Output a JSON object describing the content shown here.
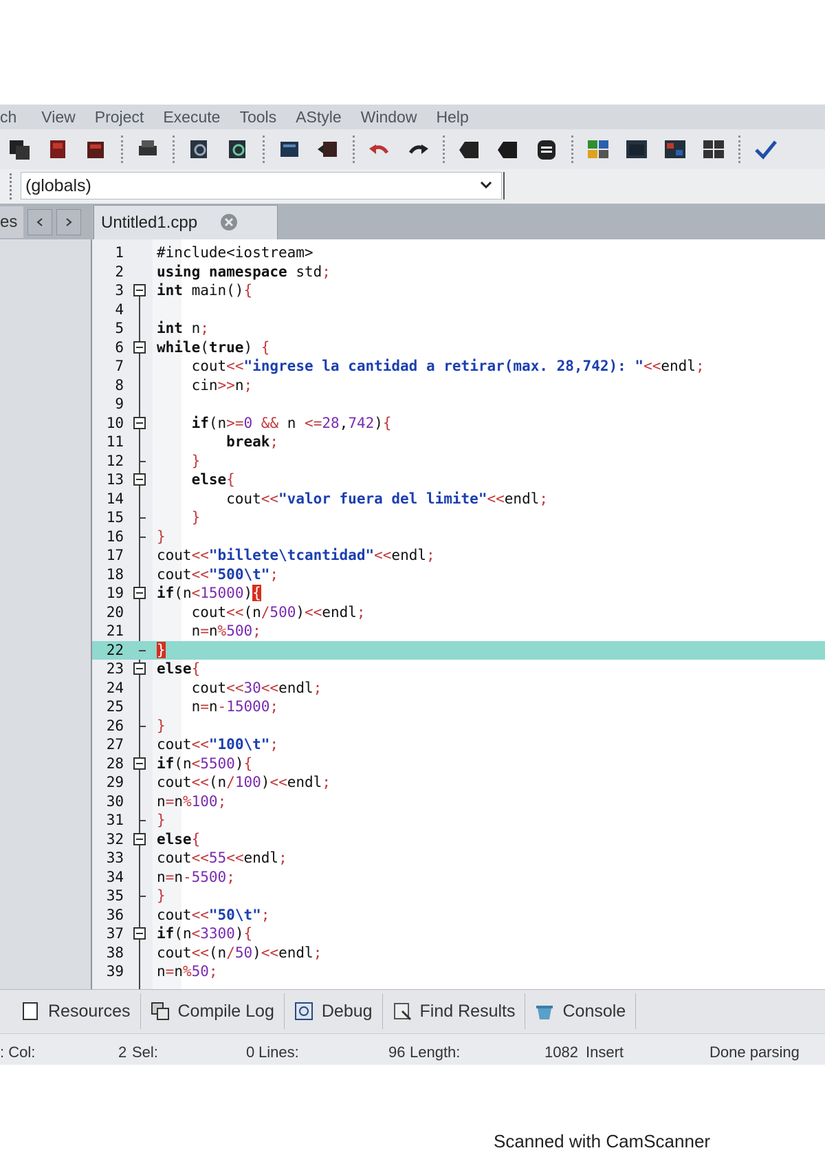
{
  "menu": [
    "ch",
    "View",
    "Project",
    "Execute",
    "Tools",
    "AStyle",
    "Window",
    "Help"
  ],
  "toolbar_icons": [
    "save-icon",
    "save-all-icon",
    "close-file-icon",
    "print-icon",
    "find-icon",
    "replace-icon",
    "indent-icon",
    "unindent-icon",
    "undo-icon",
    "redo-icon",
    "bookmark-icon",
    "goto-bookmark-icon",
    "compile-icon",
    "layout-icon",
    "panel-icon",
    "color-grid-icon",
    "tile-icon",
    "check-icon"
  ],
  "scope_combo": {
    "value": "(globals)"
  },
  "project_panel": {
    "tab_label": "es"
  },
  "file_tab": {
    "name": "Untitled1.cpp"
  },
  "code_lines": [
    "#include<iostream>",
    "using namespace std;",
    "int main(){",
    "",
    "int n;",
    "while(true) {",
    "    cout<<\"ingrese la cantidad a retirar(max. 28,742): \"<<endl;",
    "    cin>>n;",
    "",
    "    if(n>=0 && n <=28,742){",
    "        break;",
    "    }",
    "    else{",
    "        cout<<\"valor fuera del limite\"<<endl;",
    "    }",
    "}",
    "cout<<\"billete\\tcantidad\"<<endl;",
    "cout<<\"500\\t\";",
    "if(n<15000){",
    "    cout<<(n/500)<<endl;",
    "    n=n%500;",
    "}",
    "else{",
    "    cout<<30<<endl;",
    "    n=n-15000;",
    "}",
    "cout<<\"100\\t\";",
    "if(n<5500){",
    "cout<<(n/100)<<endl;",
    "n=n%100;",
    "}",
    "else{",
    "cout<<55<<endl;",
    "n=n-5500;",
    "}",
    "cout<<\"50\\t\";",
    "if(n<3300){",
    "cout<<(n/50)<<endl;",
    "n=n%50;"
  ],
  "highlighted_line": 22,
  "bottom_tabs": [
    {
      "label": "Resources",
      "icon": "resources-icon"
    },
    {
      "label": "Compile Log",
      "icon": "compile-log-icon"
    },
    {
      "label": "Debug",
      "icon": "debug-icon"
    },
    {
      "label": "Find Results",
      "icon": "find-results-icon"
    },
    {
      "label": "Console",
      "icon": "console-icon"
    }
  ],
  "status": {
    "col_label": ": Col:",
    "col_value": "2",
    "sel_label": "Sel:",
    "sel_value": "0",
    "lines_label": "Lines:",
    "lines_value": "96",
    "length_label": "Length:",
    "length_value": "1082",
    "mode": "Insert",
    "parse_status": "Done parsing"
  },
  "footer": "Scanned with CamScanner"
}
